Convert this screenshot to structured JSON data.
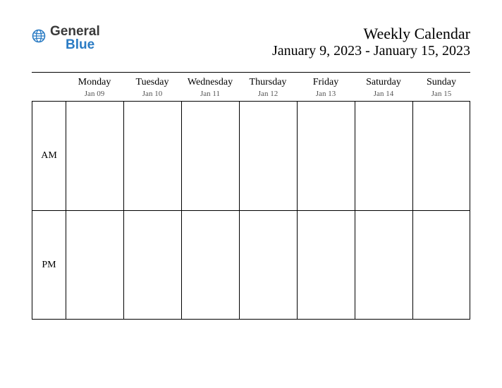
{
  "logo": {
    "general": "General",
    "blue": "Blue"
  },
  "header": {
    "title": "Weekly Calendar",
    "daterange": "January 9, 2023 - January 15, 2023"
  },
  "periods": {
    "am": "AM",
    "pm": "PM"
  },
  "days": [
    {
      "name": "Monday",
      "date": "Jan 09"
    },
    {
      "name": "Tuesday",
      "date": "Jan 10"
    },
    {
      "name": "Wednesday",
      "date": "Jan 11"
    },
    {
      "name": "Thursday",
      "date": "Jan 12"
    },
    {
      "name": "Friday",
      "date": "Jan 13"
    },
    {
      "name": "Saturday",
      "date": "Jan 14"
    },
    {
      "name": "Sunday",
      "date": "Jan 15"
    }
  ]
}
